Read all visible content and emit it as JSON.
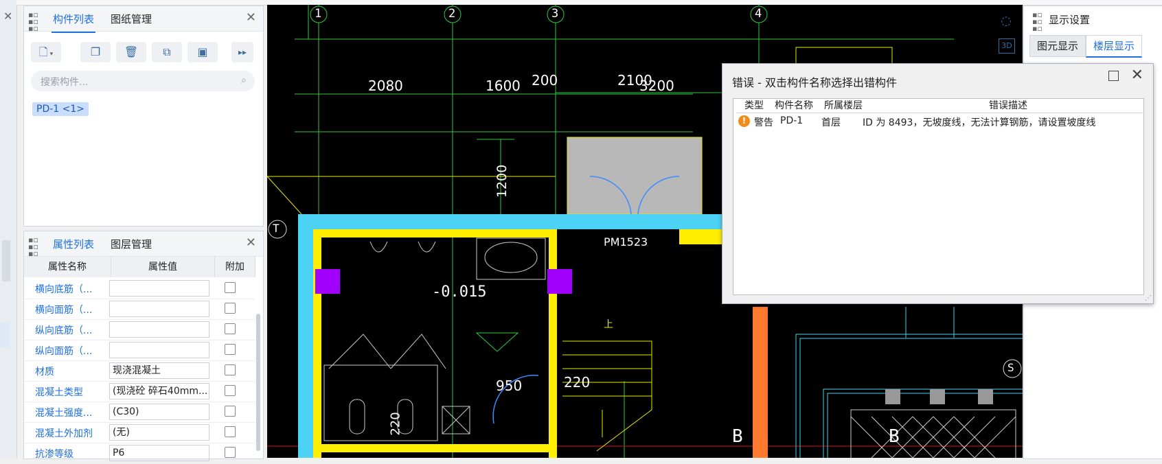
{
  "component_panel": {
    "tabs": [
      "构件列表",
      "图纸管理"
    ],
    "search_placeholder": "搜索构件...",
    "selected_component": "PD-1 <1>"
  },
  "property_panel": {
    "tabs": [
      "属性列表",
      "图层管理"
    ],
    "headers": [
      "属性名称",
      "属性值",
      "附加"
    ],
    "rows": [
      {
        "name": "横向底筋（...",
        "value": ""
      },
      {
        "name": "横向面筋（...",
        "value": ""
      },
      {
        "name": "纵向底筋（...",
        "value": ""
      },
      {
        "name": "纵向面筋（...",
        "value": ""
      },
      {
        "name": "材质",
        "value": "现浇混凝土"
      },
      {
        "name": "混凝土类型",
        "value": "(现浇砼 碎石40mm..."
      },
      {
        "name": "混凝土强度...",
        "value": "(C30)"
      },
      {
        "name": "混凝土外加剂",
        "value": "(无)"
      },
      {
        "name": "抗渗等级",
        "value": "P6"
      }
    ]
  },
  "display_settings": {
    "title": "显示设置",
    "tabs": [
      "图元显示",
      "楼层显示"
    ]
  },
  "cad": {
    "axis_labels": [
      "1",
      "2",
      "3",
      "4"
    ],
    "row_labels": [
      "T",
      "S",
      "B",
      "B"
    ],
    "dimensions": [
      "2080",
      "1600",
      "200",
      "2100",
      "3200",
      "1200",
      "950",
      "220",
      "220"
    ],
    "elevation": "-0.015",
    "door_label": "PM1523",
    "up_label": "上"
  },
  "error_dialog": {
    "title": "错误 - 双击构件名称选择出错构件",
    "headers": [
      "类型",
      "构件名称",
      "所属楼层",
      "错误描述"
    ],
    "rows": [
      {
        "type": "警告",
        "name": "PD-1",
        "floor": "首层",
        "description": "ID 为 8493，无坡度线，无法计算钢筋，请设置坡度线"
      }
    ]
  },
  "colors": {
    "accent": "#1e6fe0",
    "cad_background": "#000000",
    "warning": "#f08c1e"
  }
}
